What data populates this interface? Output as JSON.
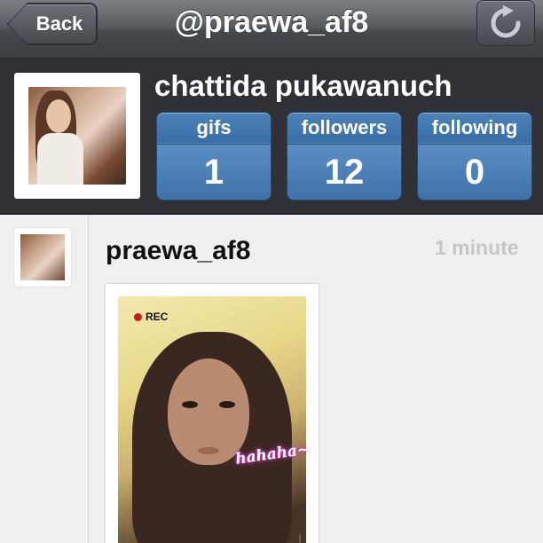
{
  "navbar": {
    "back_label": "Back",
    "title": "@praewa_af8",
    "refresh_icon": "refresh-icon"
  },
  "profile": {
    "name": "chattida pukawanuch",
    "stats": [
      {
        "label": "gifs",
        "value": "1"
      },
      {
        "label": "followers",
        "value": "12"
      },
      {
        "label": "following",
        "value": "0"
      }
    ]
  },
  "feed": {
    "items": [
      {
        "username": "praewa_af8",
        "time": "1 minute",
        "gif": {
          "rec_label": "REC",
          "caption": "hahaha~"
        }
      }
    ]
  },
  "colors": {
    "navbar": "#4a4d52",
    "profile_bg": "#2f3136",
    "stat_blue": "#3f72aa",
    "feed_bg": "#f0f0f0",
    "rec_red": "#d01818",
    "caption_glow": "#e03ad0"
  }
}
